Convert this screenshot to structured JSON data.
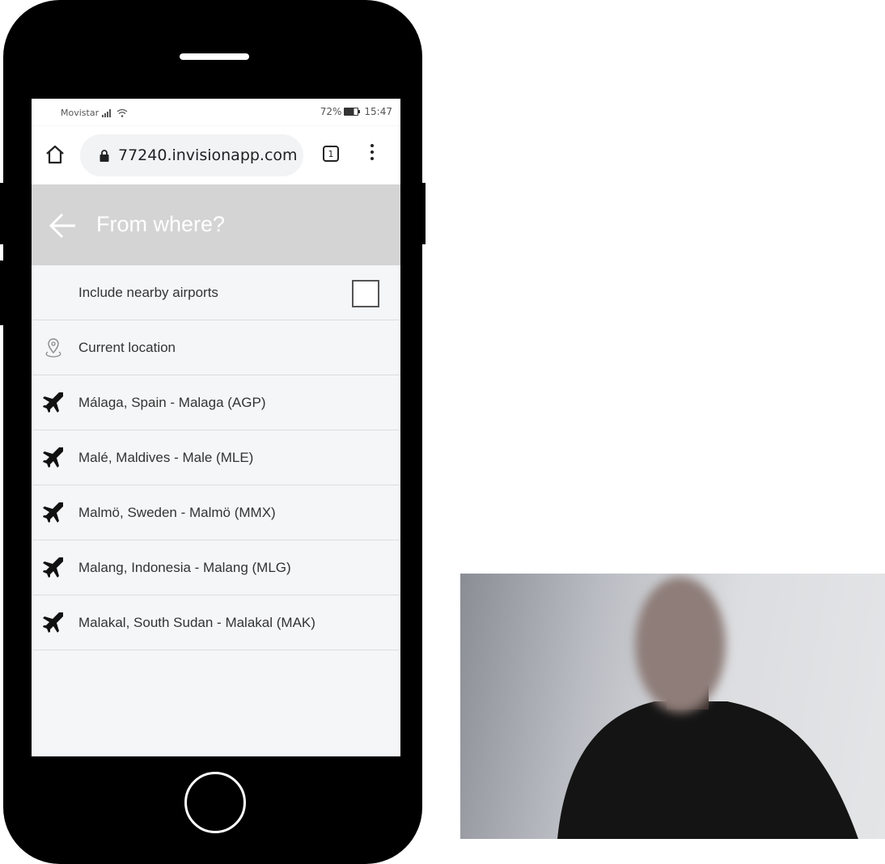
{
  "status_bar": {
    "carrier": "Movistar",
    "battery": "72%",
    "time": "15:47"
  },
  "browser": {
    "url": "77240.invisionapp.com",
    "tab_count": "1",
    "icons": [
      "home-icon",
      "lock-icon",
      "tabs-icon",
      "menu-dots-icon"
    ]
  },
  "app_header": {
    "title": "From where?",
    "back_icon": "arrow-left-icon",
    "background": "#d4d4d4",
    "title_color": "#ffffff"
  },
  "options": {
    "nearby_label": "Include nearby airports",
    "nearby_checked": false,
    "current_location_label": "Current location"
  },
  "results": [
    {
      "label": "Málaga, Spain - Malaga (AGP)",
      "icon": "plane-icon"
    },
    {
      "label": "Malé, Maldives - Male (MLE)",
      "icon": "plane-icon"
    },
    {
      "label": "Malmö, Sweden - Malmö (MMX)",
      "icon": "plane-icon"
    },
    {
      "label": "Malang, Indonesia - Malang (MLG)",
      "icon": "plane-icon"
    },
    {
      "label": "Malakal, South Sudan - Malakal (MAK)",
      "icon": "plane-icon"
    }
  ]
}
